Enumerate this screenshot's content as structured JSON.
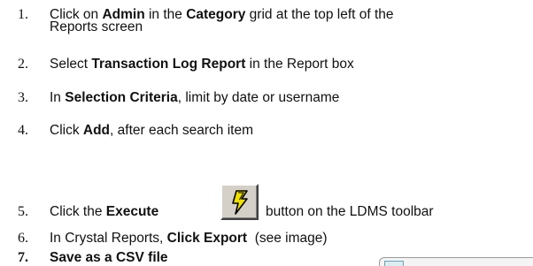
{
  "steps": [
    {
      "num": "1.",
      "parts": [
        {
          "t": "Click on "
        },
        {
          "t": "Admin",
          "b": true
        },
        {
          "t": " in the "
        },
        {
          "t": "Category",
          "b": true
        },
        {
          "t": " grid at the top left of the"
        }
      ],
      "line2": "Reports screen"
    },
    {
      "num": "2.",
      "parts": [
        {
          "t": "Select "
        },
        {
          "t": "Transaction Log Report",
          "b": true
        },
        {
          "t": " in the Report box"
        }
      ]
    },
    {
      "num": "3.",
      "parts": [
        {
          "t": "In "
        },
        {
          "t": "Selection Criteria",
          "b": true
        },
        {
          "t": ", limit by date or username"
        }
      ]
    },
    {
      "num": "4.",
      "parts": [
        {
          "t": "Click "
        },
        {
          "t": "Add",
          "b": true
        },
        {
          "t": ", after each search item"
        }
      ]
    },
    {
      "num": "5.",
      "parts": [
        {
          "t": "Click the "
        },
        {
          "t": "Execute",
          "b": true
        }
      ],
      "after_button": "button on the LDMS toolbar"
    },
    {
      "num": "6.",
      "parts": [
        {
          "t": "In Crystal Reports, "
        },
        {
          "t": "Click Export",
          "b": true
        },
        {
          "t": "  (see image)"
        }
      ]
    },
    {
      "num": "7.",
      "parts": [
        {
          "t": "Save as a CSV file",
          "b": true
        }
      ]
    }
  ],
  "execute_button": {
    "icon": "lightning-bolt-icon",
    "icon_color": "#f0e000",
    "bg": "#d4d0c8"
  },
  "thumbnail": {
    "caption": ""
  }
}
